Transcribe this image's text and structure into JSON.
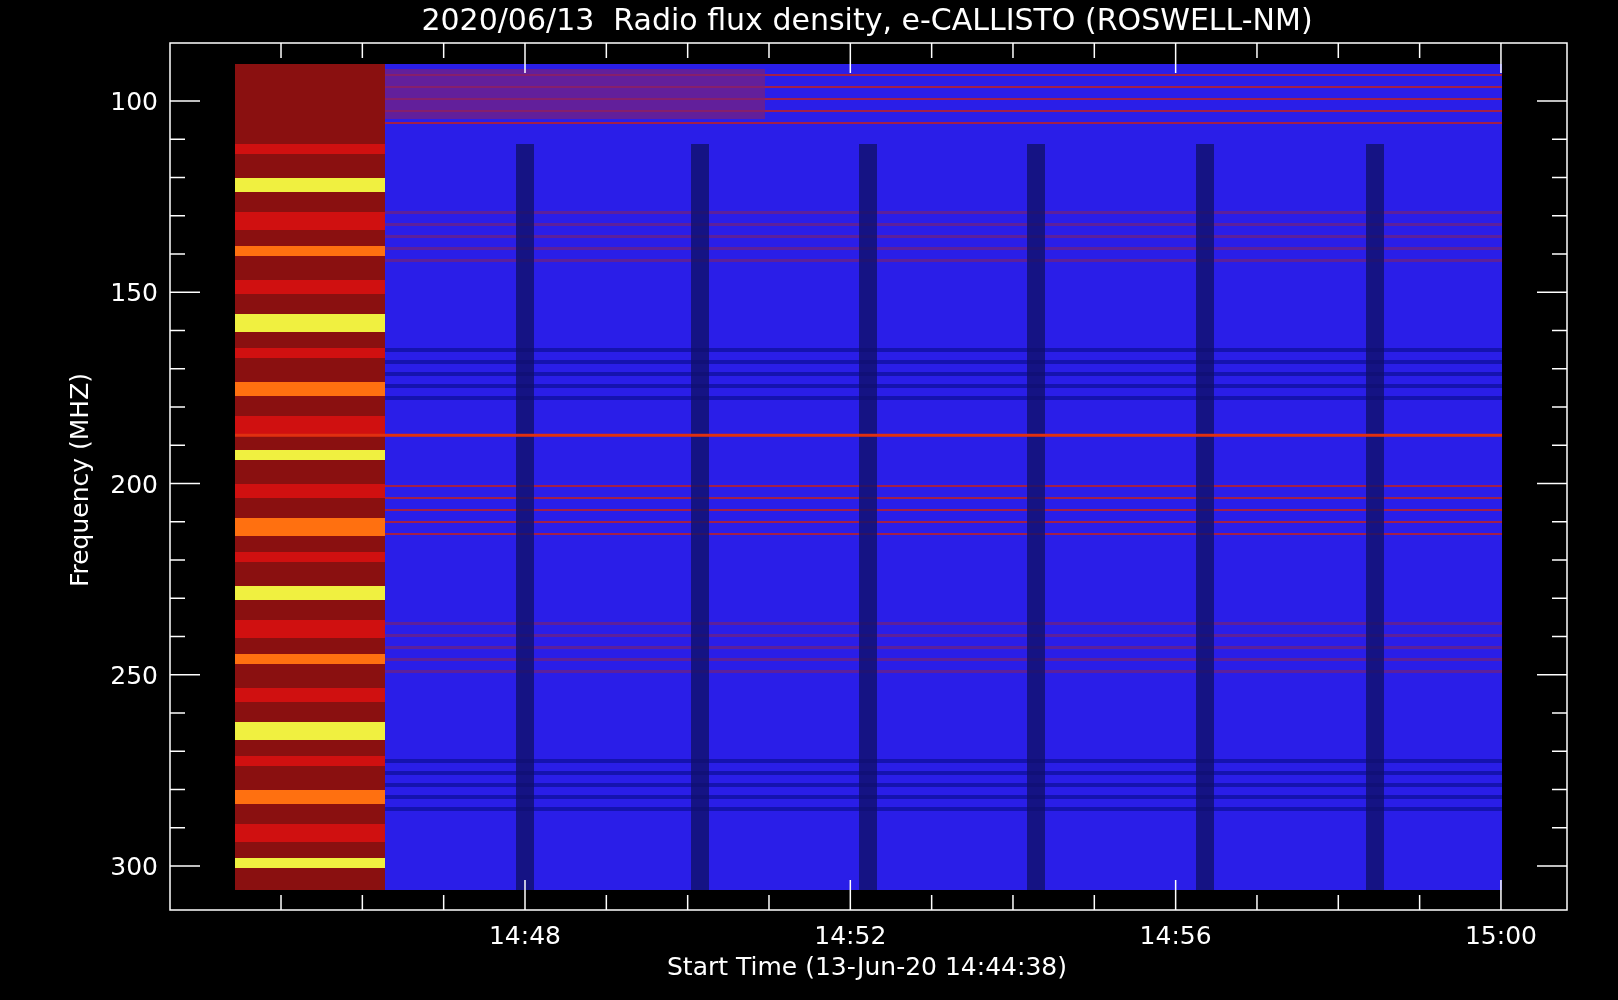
{
  "title": "2020/06/13  Radio flux density, e-CALLISTO (ROSWELL-NM)",
  "y_axis": {
    "label": "Frequency (MHZ)",
    "ticks": [
      "100",
      "150",
      "200",
      "250",
      "300"
    ]
  },
  "x_axis": {
    "label": "Start Time (13-Jun-20 14:44:38)",
    "ticks": [
      "14:48",
      "14:52",
      "14:56",
      "15:00"
    ]
  }
}
